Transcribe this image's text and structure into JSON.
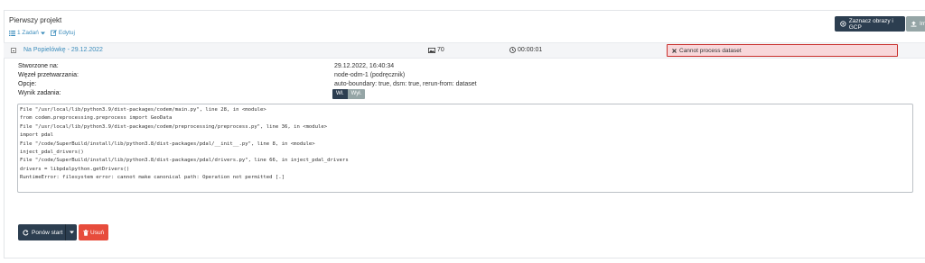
{
  "project": {
    "title": "Pierwszy projekt",
    "tasks_link": "1 Zadań",
    "edit_link": "Edytuj",
    "gcp_button": "Zaznacz obrazy i GCP",
    "import_button": "Im"
  },
  "task": {
    "name": "Na Popielówkę - 29.12.2022",
    "images": "70",
    "elapsed": "00:00:01",
    "status": "Cannot process dataset",
    "status_color": "#f8d7da"
  },
  "details": {
    "created_label": "Stworzone na:",
    "created_value": "29.12.2022, 16:40:34",
    "node_label": "Węzeł przetwarzania:",
    "node_value": "node-odm-1 (podręcznik)",
    "options_label": "Opcje:",
    "options_value": "auto-boundary: true, dsm: true, rerun-from: dataset",
    "output_label": "Wynik zadania:",
    "output_on": "Wł.",
    "output_off": "Wył."
  },
  "console": [
    "File \"/usr/local/lib/python3.9/dist-packages/codem/main.py\", line 28, in <module>",
    "from codem.preprocessing.preprocess import GeoData",
    "File \"/usr/local/lib/python3.9/dist-packages/codem/preprocessing/preprocess.py\", line 36, in <module>",
    "import pdal",
    "File \"/code/SuperBuild/install/lib/python3.8/dist-packages/pdal/__init__.py\", line 8, in <module>",
    "inject_pdal_drivers()",
    "File \"/code/SuperBuild/install/lib/python3.8/dist-packages/pdal/drivers.py\", line 66, in inject_pdal_drivers",
    "drivers = libpdalpython.getDrivers()",
    "RuntimeError: filesystem error: cannot make canonical path: Operation not permitted [.]"
  ],
  "actions": {
    "restart": "Ponów start",
    "delete": "Usuń"
  },
  "colors": {
    "primary": "#2c3e50",
    "danger": "#e74c3c",
    "link": "#3c8dbc",
    "muted": "#95a5a6"
  }
}
